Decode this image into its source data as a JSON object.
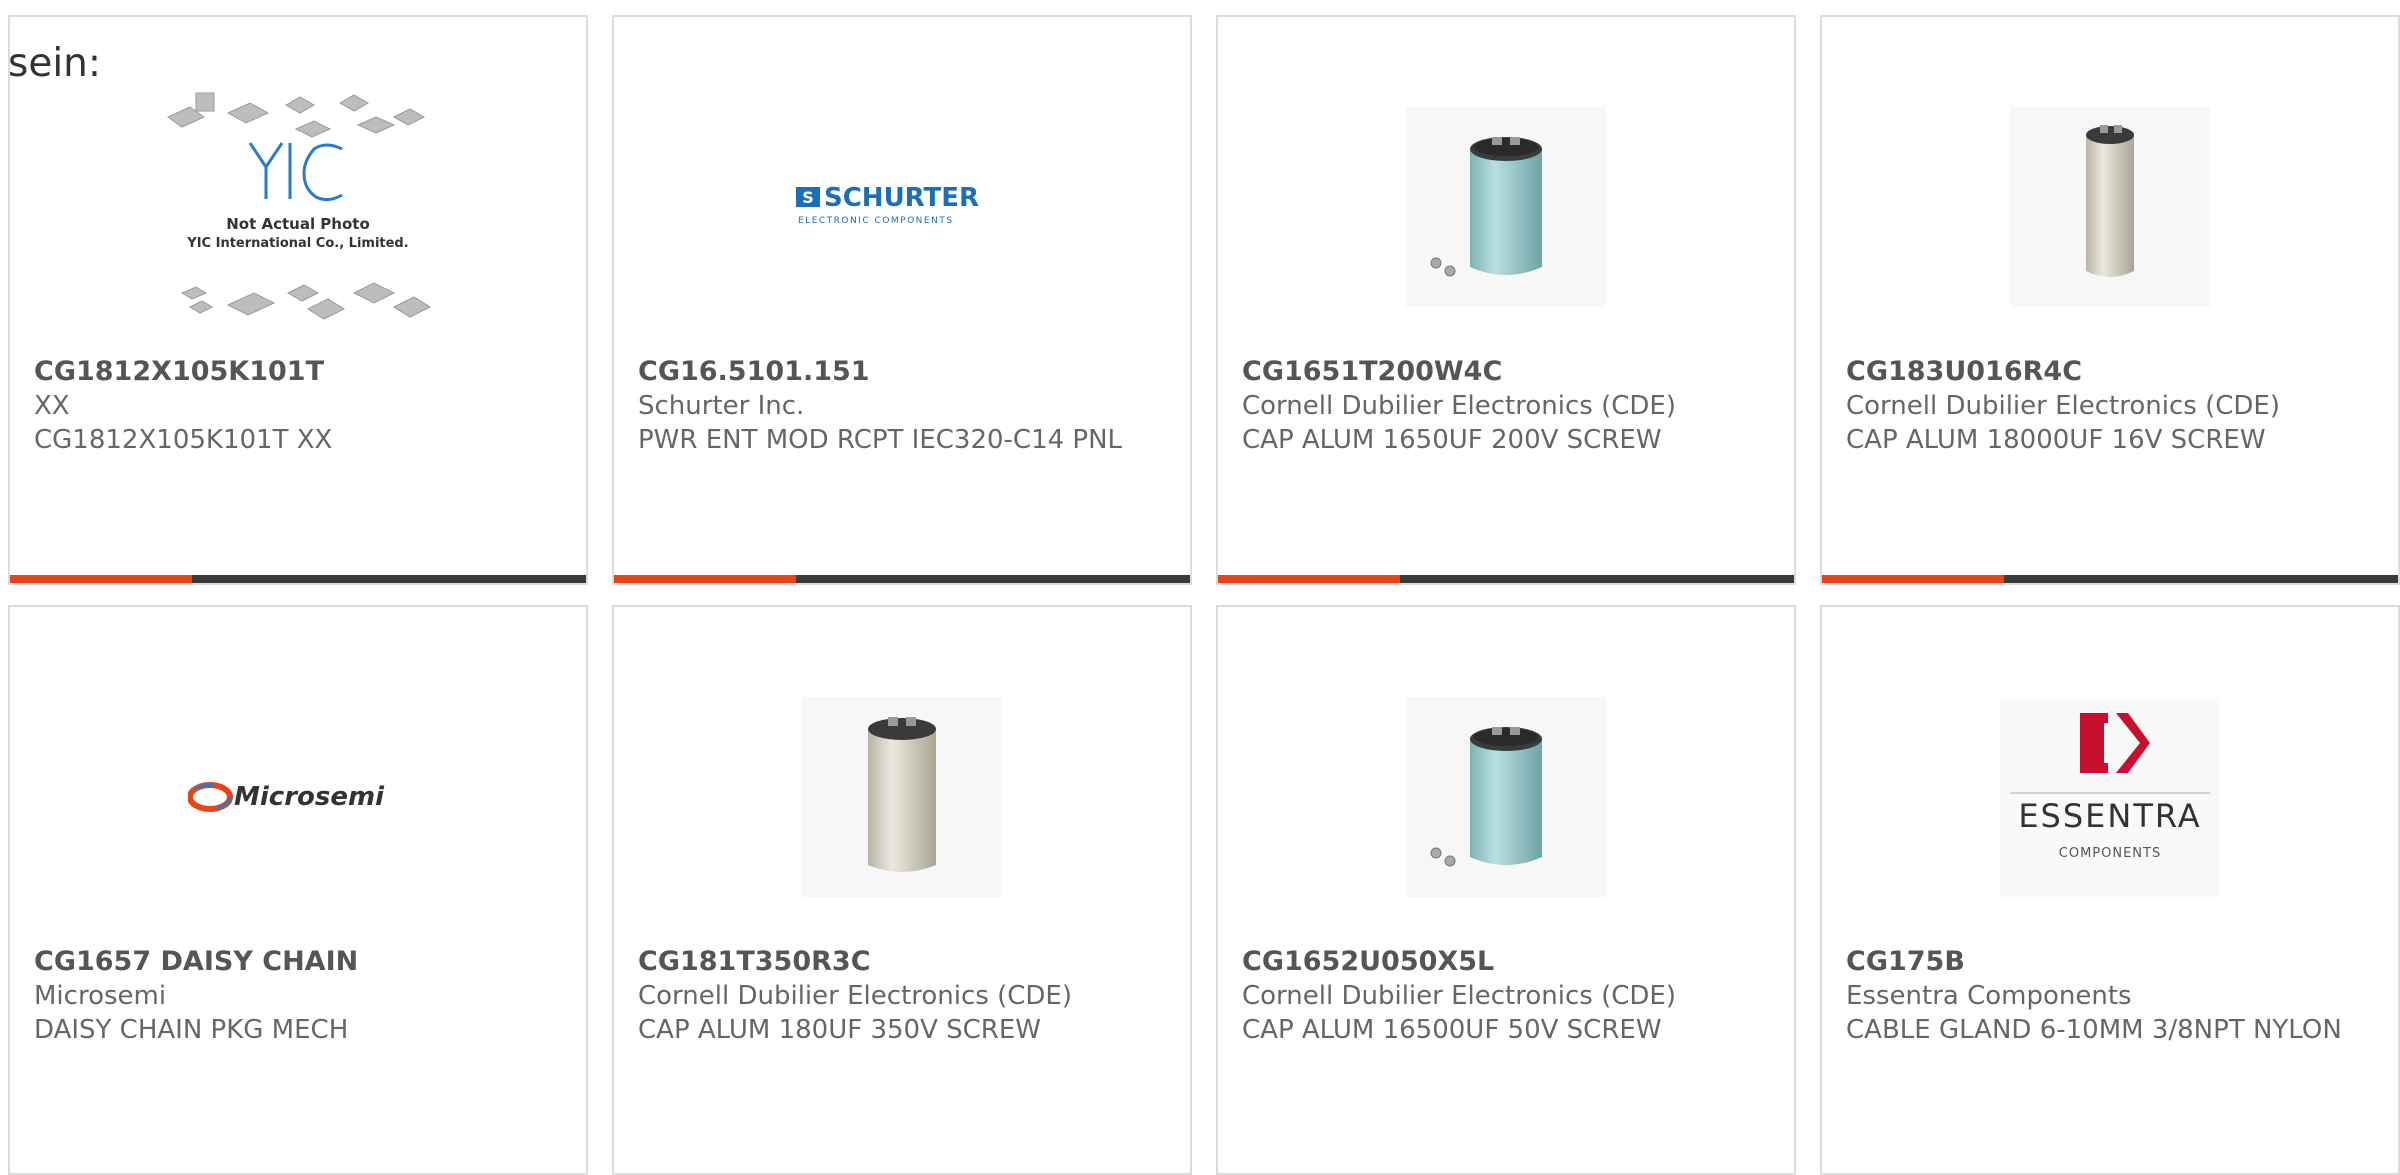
{
  "intro_text": "sein:",
  "colors": {
    "accent": "#e8441c",
    "bar": "#3a3a3a",
    "border": "#dcdcdc"
  },
  "products": [
    {
      "part_number": "CG1812X105K101T",
      "manufacturer": "XX",
      "description": "CG1812X105K101T XX",
      "image": "yic-not-actual-photo",
      "image_text_1": "Not Actual Photo",
      "image_text_2": "YIC International Co., Limited."
    },
    {
      "part_number": "CG16.5101.151",
      "manufacturer": "Schurter Inc.",
      "description": "PWR ENT MOD RCPT IEC320-C14 PNL",
      "image": "schurter-logo",
      "logo_text": "SCHURTER",
      "logo_subtext": "ELECTRONIC COMPONENTS"
    },
    {
      "part_number": "CG1651T200W4C",
      "manufacturer": "Cornell Dubilier Electronics (CDE)",
      "description": "CAP ALUM 1650UF 200V SCREW",
      "image": "blue-screw-capacitor"
    },
    {
      "part_number": "CG183U016R4C",
      "manufacturer": "Cornell Dubilier Electronics (CDE)",
      "description": "CAP ALUM 18000UF 16V SCREW",
      "image": "silver-screw-capacitor"
    },
    {
      "part_number": "CG1657 DAISY CHAIN",
      "manufacturer": "Microsemi",
      "description": "DAISY CHAIN PKG MECH",
      "image": "microsemi-logo",
      "logo_text": "Microsemi"
    },
    {
      "part_number": "CG181T350R3C",
      "manufacturer": "Cornell Dubilier Electronics (CDE)",
      "description": "CAP ALUM 180UF 350V SCREW",
      "image": "silver-screw-capacitor"
    },
    {
      "part_number": "CG1652U050X5L",
      "manufacturer": "Cornell Dubilier Electronics (CDE)",
      "description": "CAP ALUM 16500UF 50V SCREW",
      "image": "blue-screw-capacitor"
    },
    {
      "part_number": "CG175B",
      "manufacturer": "Essentra Components",
      "description": "CABLE GLAND 6-10MM 3/8NPT NYLON",
      "image": "essentra-logo",
      "logo_text": "ESSENTRA",
      "logo_subtext": "COMPONENTS"
    }
  ]
}
